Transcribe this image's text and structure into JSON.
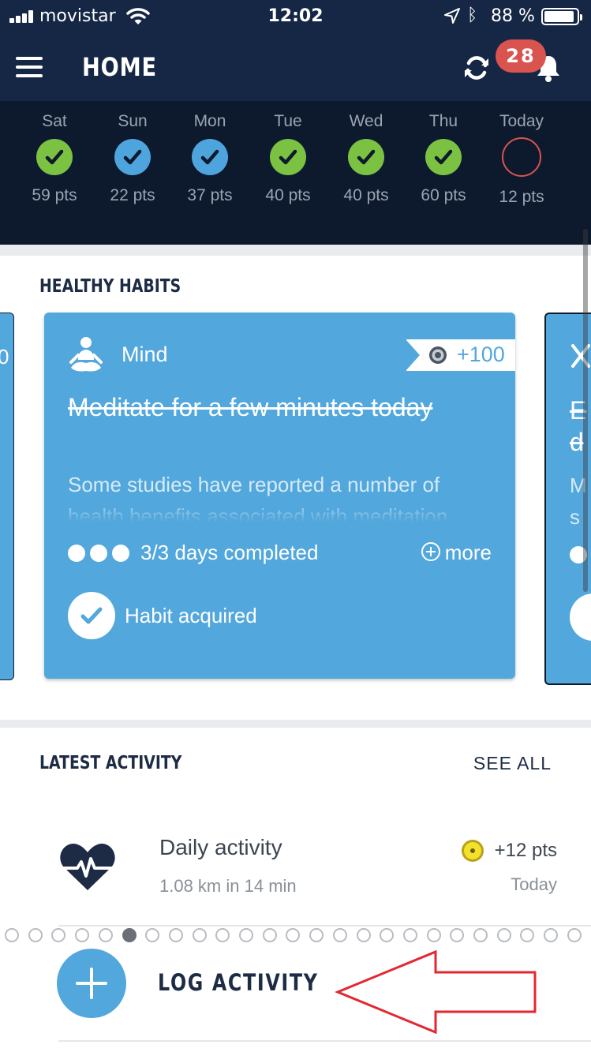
{
  "status_bar": {
    "carrier": "movistar",
    "time": "12:02",
    "battery": "88 %"
  },
  "header": {
    "title": "HOME",
    "notification_count": "28"
  },
  "week": [
    {
      "day": "Sat",
      "points": "59 pts",
      "state": "green"
    },
    {
      "day": "Sun",
      "points": "22 pts",
      "state": "blue"
    },
    {
      "day": "Mon",
      "points": "37 pts",
      "state": "blue"
    },
    {
      "day": "Tue",
      "points": "40 pts",
      "state": "green"
    },
    {
      "day": "Wed",
      "points": "40 pts",
      "state": "green"
    },
    {
      "day": "Thu",
      "points": "60 pts",
      "state": "green"
    },
    {
      "day": "Today",
      "points": "12 pts",
      "state": "empty"
    }
  ],
  "habits": {
    "title": "HEALTHY HABITS",
    "left_peek_text": "0",
    "right_peek_text": "E",
    "right_peek_line2": "d",
    "right_peek_line3": "M",
    "right_peek_line4": "s",
    "card": {
      "category": "Mind",
      "category_icon": "meditation-icon",
      "reward": "+100",
      "title": "Meditate for a few minutes today",
      "description": "Some studies have reported a number of health benefits associated with meditation.",
      "progress_completed": 3,
      "progress_total": 3,
      "progress_label": "3/3 days completed",
      "more_label": "more",
      "status_label": "Habit acquired"
    },
    "pager": {
      "total": 25,
      "active_index": 5
    }
  },
  "latest_activity": {
    "title": "LATEST ACTIVITY",
    "see_all": "SEE ALL",
    "items": [
      {
        "name": "Daily activity",
        "detail": "1.08 km in 14 min",
        "points": "+12 pts",
        "when": "Today",
        "icon": "heart-pulse-icon"
      }
    ],
    "log_label": "LOG ACTIVITY"
  },
  "colors": {
    "nav": "#162746",
    "strip": "#0d1a2e",
    "card": "#52a7dc",
    "green": "#7cc242",
    "blue": "#4ea4dc",
    "badge": "#d9534f",
    "annotation": "#e5262e"
  }
}
